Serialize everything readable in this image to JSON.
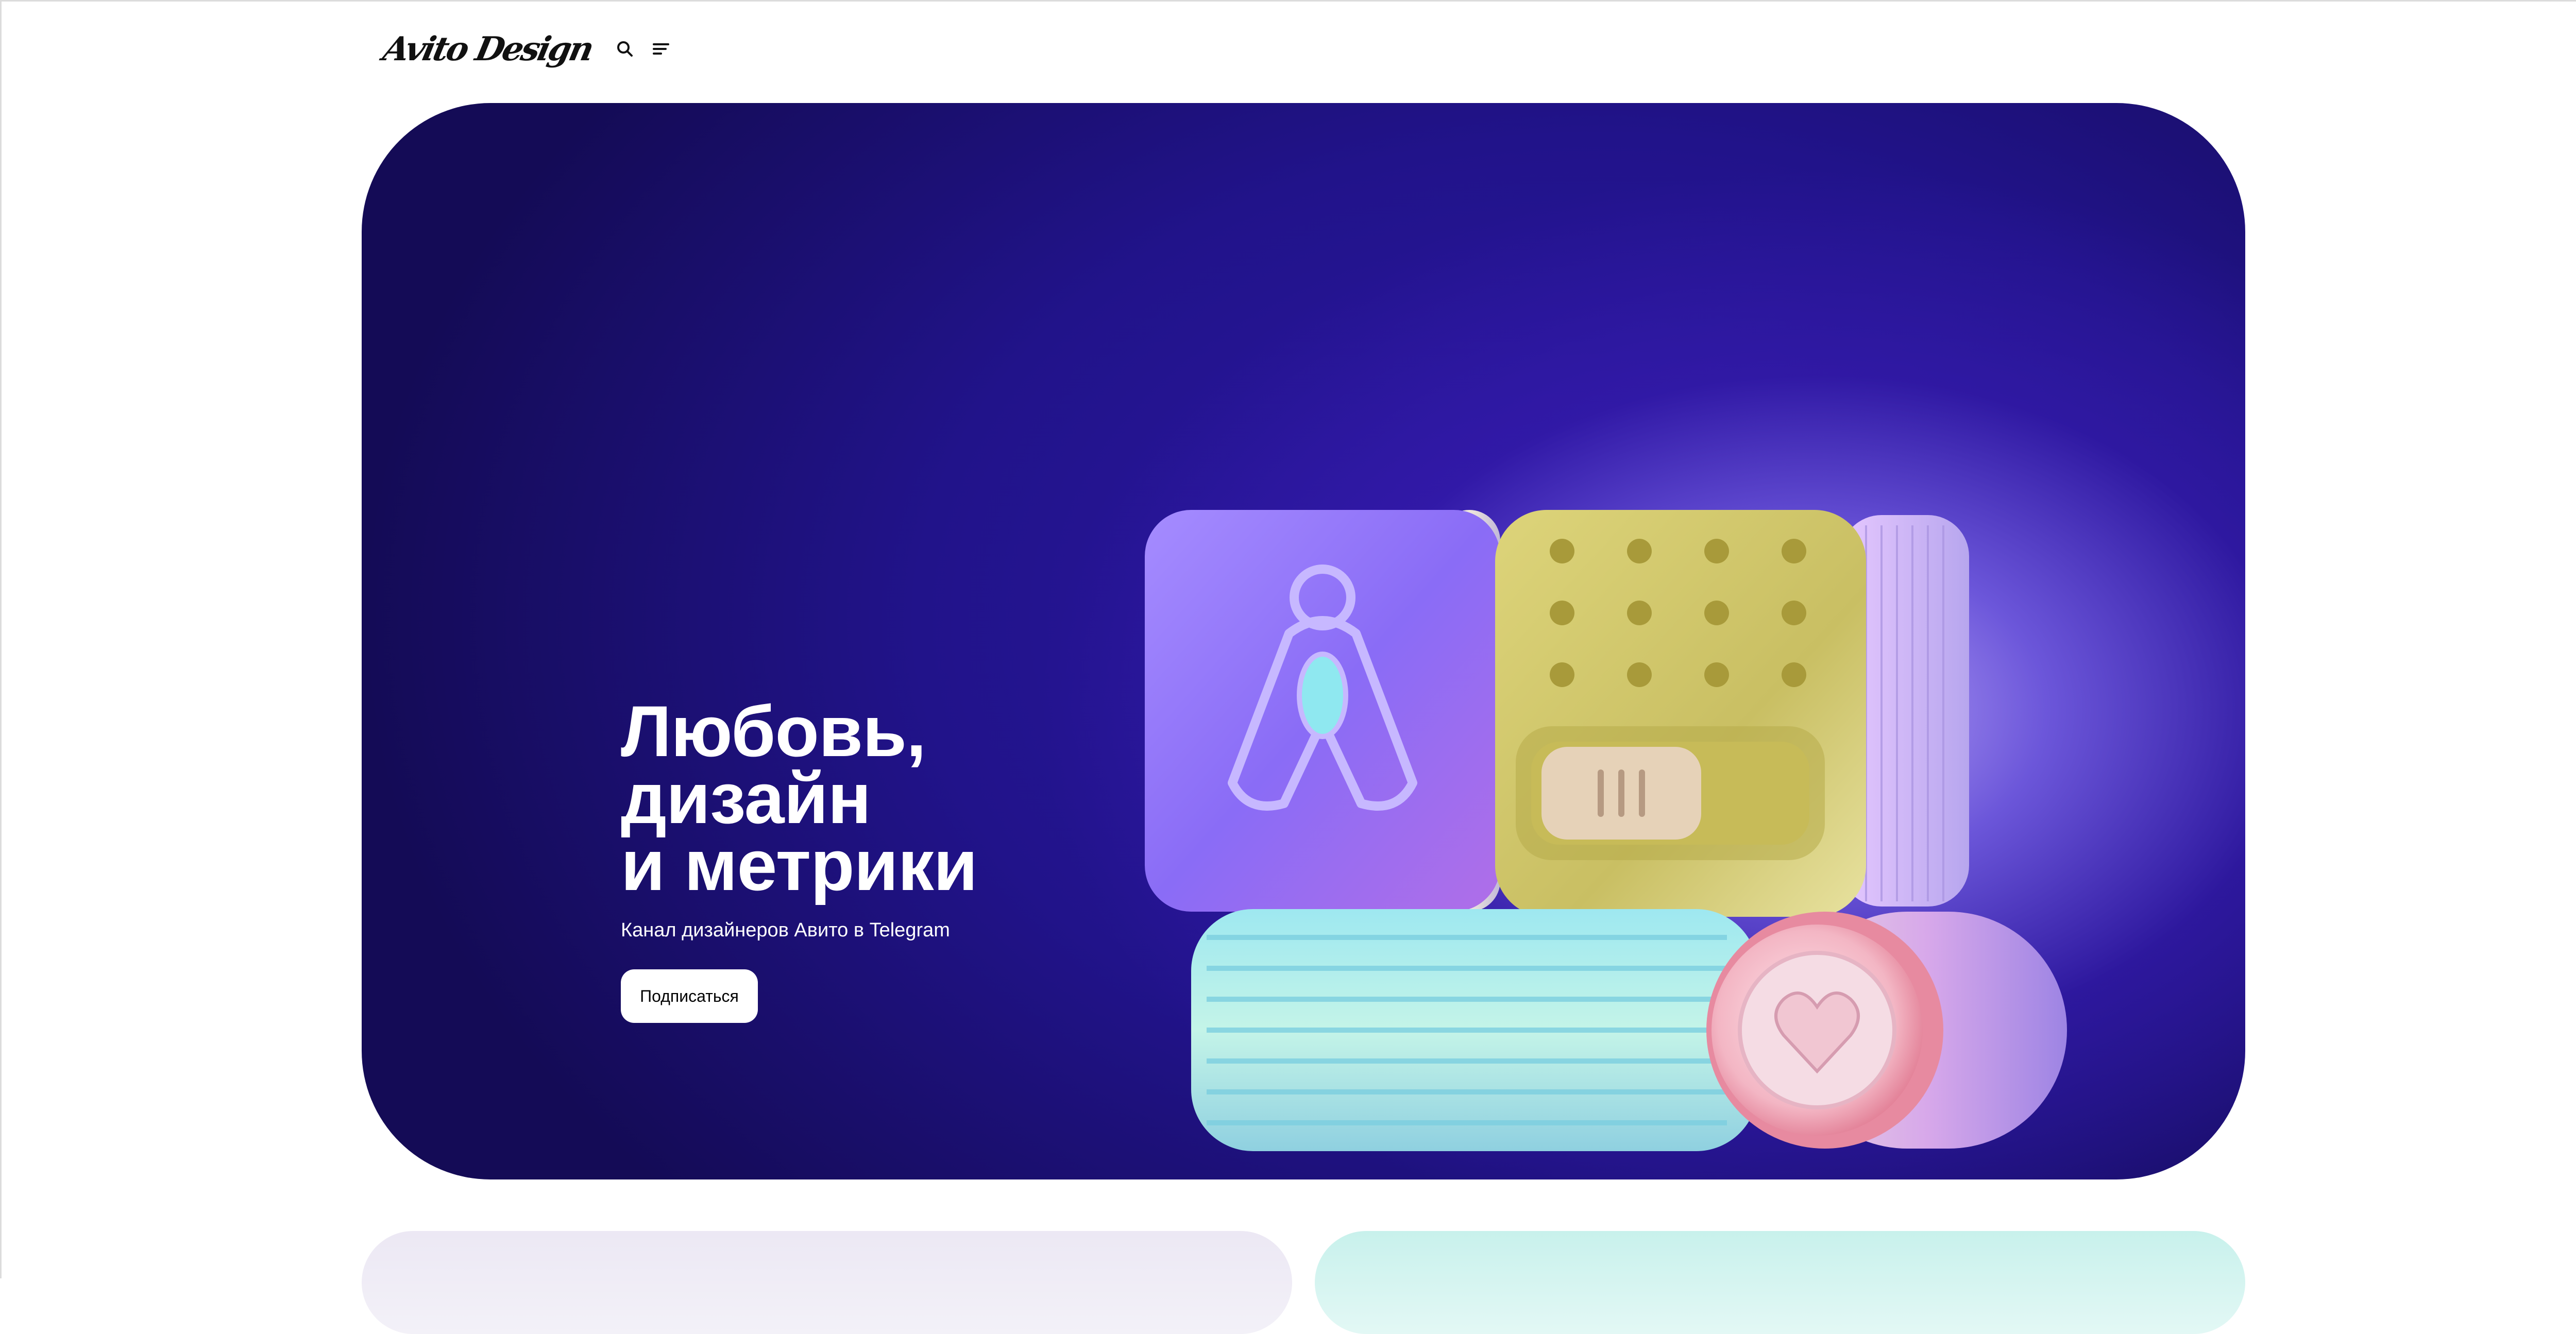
{
  "header": {
    "logo_text": "Avito Design",
    "search_icon": "search-icon",
    "menu_icon": "menu-icon"
  },
  "hero": {
    "title_lines": [
      "Любовь,",
      "дизайн",
      "и метрики"
    ],
    "subtitle": "Канал дизайнеров Авито в Telegram",
    "subscribe_label": "Подписаться",
    "art_icons": [
      "avito-logo-icon",
      "dots-grid-icon",
      "toggle-switch-icon",
      "ribbed-cylinder-icon",
      "heart-icon"
    ]
  },
  "colors": {
    "hero_bg": "#21138a",
    "hero_glow": "#c4b0ff",
    "button_bg": "#ffffff",
    "card_left_bg": "#ece8f4",
    "card_right_bg": "#c8f1ec"
  }
}
